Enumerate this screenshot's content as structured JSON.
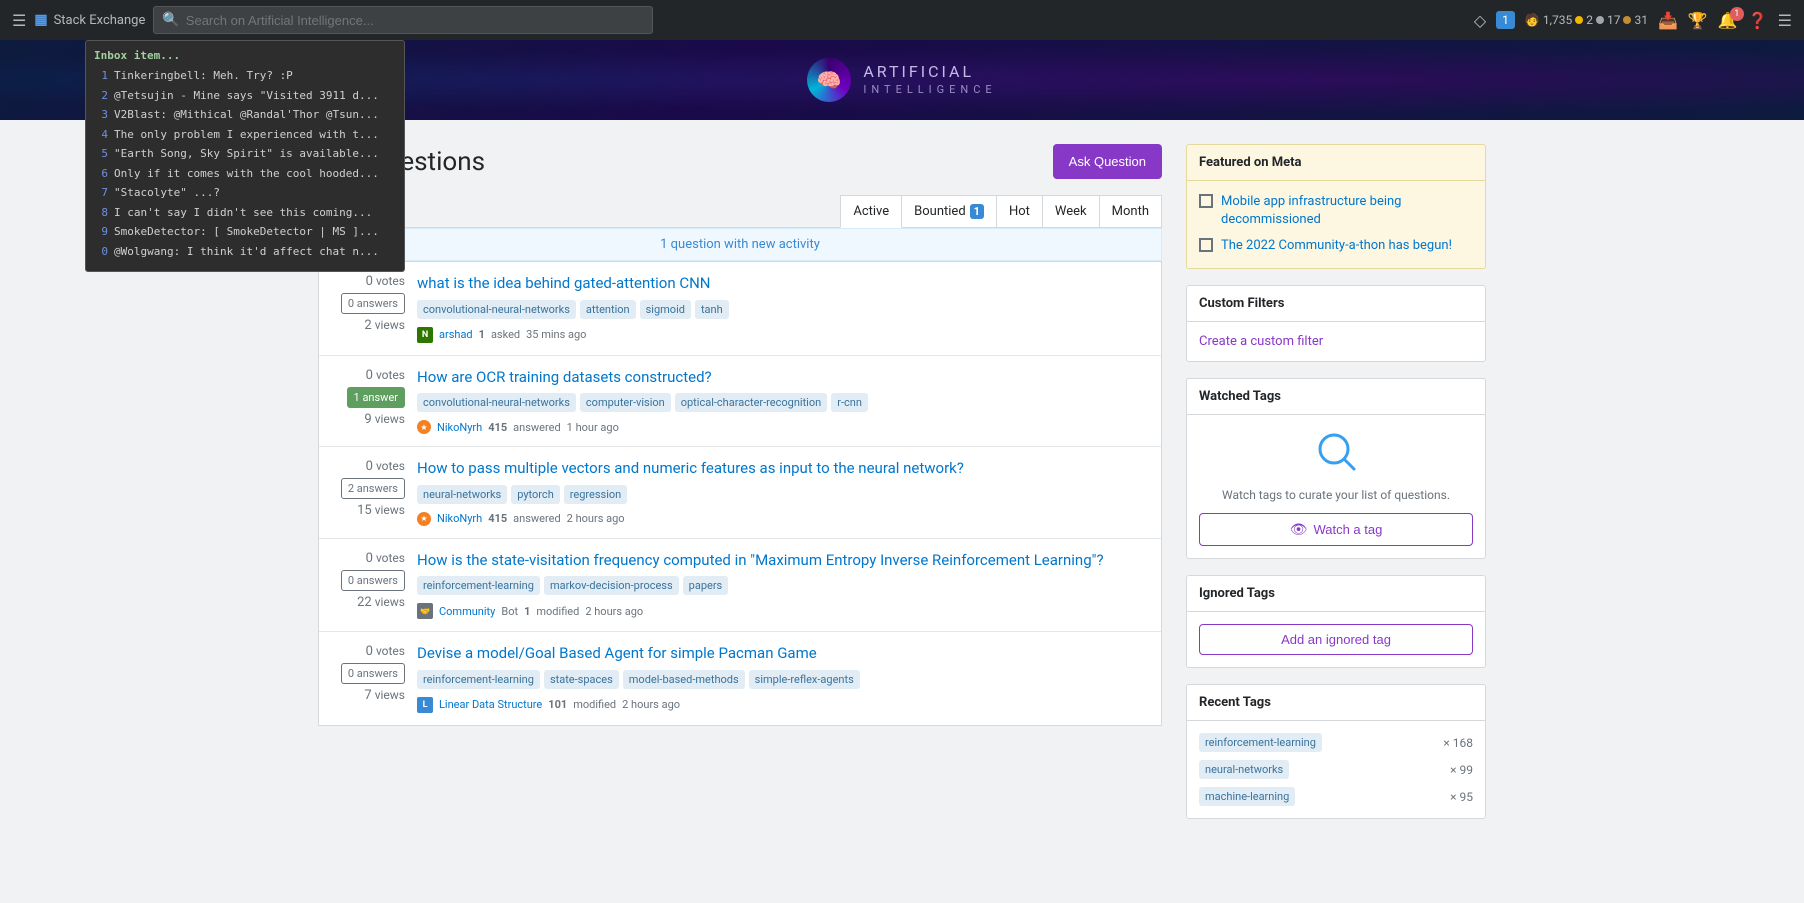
{
  "topnav": {
    "brand": "Stack Exchange",
    "search_placeholder": "Search on Artificial Intelligence...",
    "user_rep": "1,735",
    "gold_count": "2",
    "silver_count": "17",
    "bronze_count": "31",
    "notification_count": "1"
  },
  "site": {
    "name": "ARTIFICIAL",
    "subname": "INTELLIGENCE"
  },
  "page": {
    "title": "Top Questions",
    "ask_button": "Ask Question"
  },
  "tabs": [
    {
      "label": "Active",
      "active": true
    },
    {
      "label": "Bountied",
      "badge": "1"
    },
    {
      "label": "Hot"
    },
    {
      "label": "Week"
    },
    {
      "label": "Month"
    }
  ],
  "activity_bar": {
    "text": "1 question with new activity"
  },
  "questions": [
    {
      "votes": "0",
      "votes_label": "votes",
      "answers": "0",
      "answers_label": "answers",
      "views": "2",
      "views_label": "views",
      "has_answers": false,
      "title": "what is the idea behind gated-attention CNN",
      "tags": [
        "convolutional-neural-networks",
        "attention",
        "sigmoid",
        "tanh"
      ],
      "user_name": "arshad",
      "user_rep": "1",
      "user_action": "asked",
      "user_time": "35 mins ago",
      "avatar_letter": "N",
      "avatar_color": "av-green"
    },
    {
      "votes": "0",
      "votes_label": "votes",
      "answers": "1",
      "answers_label": "answer",
      "views": "9",
      "views_label": "views",
      "has_answers": true,
      "title": "How are OCR training datasets constructed?",
      "tags": [
        "convolutional-neural-networks",
        "computer-vision",
        "optical-character-recognition",
        "r-cnn"
      ],
      "user_name": "NikoNyrh",
      "user_rep": "415",
      "user_action": "answered",
      "user_time": "1 hour ago",
      "avatar_letter": "★",
      "avatar_color": "av-orange",
      "is_mod": true
    },
    {
      "votes": "0",
      "votes_label": "votes",
      "answers": "2",
      "answers_label": "answers",
      "views": "15",
      "views_label": "views",
      "has_answers": false,
      "title": "How to pass multiple vectors and numeric features as input to the neural network?",
      "tags": [
        "neural-networks",
        "pytorch",
        "regression"
      ],
      "user_name": "NikoNyrh",
      "user_rep": "415",
      "user_action": "answered",
      "user_time": "2 hours ago",
      "avatar_letter": "★",
      "avatar_color": "av-orange",
      "is_mod": true
    },
    {
      "votes": "0",
      "votes_label": "votes",
      "answers": "0",
      "answers_label": "answers",
      "views": "22",
      "views_label": "views",
      "has_answers": false,
      "title": "How is the state-visitation frequency computed in \"Maximum Entropy Inverse Reinforcement Learning\"?",
      "tags": [
        "reinforcement-learning",
        "markov-decision-process",
        "papers"
      ],
      "user_name": "Community Bot",
      "user_rep": "1",
      "user_action": "modified",
      "user_time": "2 hours ago",
      "avatar_letter": "C",
      "avatar_color": "av-community"
    },
    {
      "votes": "0",
      "votes_label": "votes",
      "answers": "0",
      "answers_label": "answers",
      "views": "7",
      "views_label": "views",
      "has_answers": false,
      "title": "Devise a model/Goal Based Agent for simple Pacman Game",
      "tags": [
        "reinforcement-learning",
        "state-spaces",
        "model-based-methods",
        "simple-reflex-agents"
      ],
      "user_name": "Linear Data Structure",
      "user_rep": "101",
      "user_action": "modified",
      "user_time": "2 hours ago",
      "avatar_letter": "L",
      "avatar_color": "av-blue"
    }
  ],
  "sidebar": {
    "featured": {
      "header": "Featured on Meta",
      "items": [
        "Mobile app infrastructure being decommissioned",
        "The 2022 Community-a-thon has begun!"
      ]
    },
    "custom_filters": {
      "header": "Custom Filters",
      "create_link": "Create a custom filter"
    },
    "watched_tags": {
      "header": "Watched Tags",
      "desc": "Watch tags to curate your list of questions.",
      "button": "Watch a tag"
    },
    "ignored_tags": {
      "header": "Ignored Tags",
      "button": "Add an ignored tag"
    },
    "recent_tags": {
      "header": "Recent Tags",
      "tags": [
        {
          "name": "reinforcement-learning",
          "count": "× 168"
        },
        {
          "name": "neural-networks",
          "count": "× 99"
        },
        {
          "name": "machine-learning",
          "count": "× 95"
        }
      ]
    }
  },
  "inbox": {
    "title": "Inbox item...",
    "items": [
      {
        "num": "1",
        "text": "Tinkeringbell: Meh. Try? :P"
      },
      {
        "num": "2",
        "text": "@Tetsujin - Mine says \"Visited 3911 d..."
      },
      {
        "num": "3",
        "text": "V2Blast: @Mithical @Randal'Thor @Tsun..."
      },
      {
        "num": "4",
        "text": "The only problem I experienced with t..."
      },
      {
        "num": "5",
        "text": "\"Earth Song, Sky Spirit\" is available..."
      },
      {
        "num": "6",
        "text": "Only if it comes with the cool hooded..."
      },
      {
        "num": "7",
        "text": "\"Stacolyte\" ...?"
      },
      {
        "num": "8",
        "text": "I can't say I didn't see this coming..."
      },
      {
        "num": "9",
        "text": "SmokeDetector: [ SmokeDetector | MS ]..."
      },
      {
        "num": "0",
        "text": "@Wolgwang: I think it'd affect chat n..."
      }
    ]
  }
}
